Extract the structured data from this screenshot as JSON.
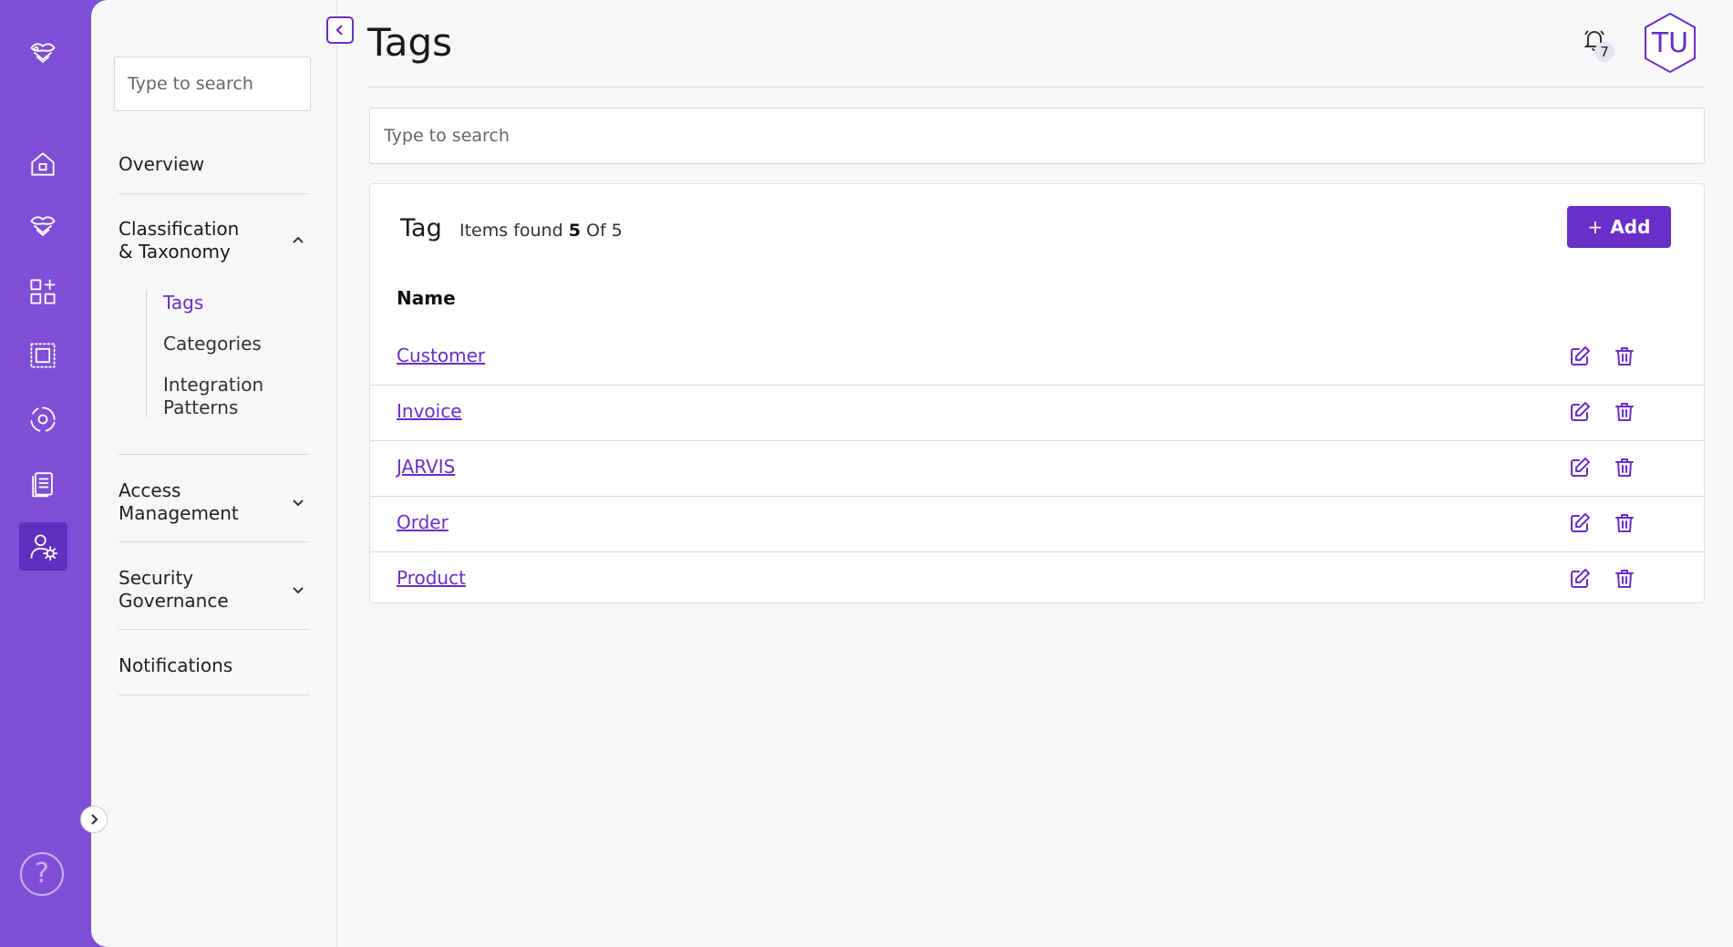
{
  "rail": {
    "icons": [
      "brand-logo-icon",
      "home-icon",
      "bee-icon",
      "apps-add-icon",
      "select-area-icon",
      "target-icon",
      "documents-icon",
      "user-settings-icon"
    ],
    "help_glyph": "?"
  },
  "subnav": {
    "search_placeholder": "Type to search",
    "overview": "Overview",
    "classification": "Classification & Taxonomy",
    "sub_items": [
      "Tags",
      "Categories",
      "Integration Patterns"
    ],
    "access": "Access Management",
    "security": "Security Governance",
    "notifications": "Notifications"
  },
  "header": {
    "title": "Tags",
    "notification_count": "7",
    "avatar_initials": "TU"
  },
  "main": {
    "search_placeholder": "Type to search",
    "card_title": "Tag",
    "items_found_label": "Items found",
    "items_found_count": "5",
    "items_found_total": "Of 5",
    "add_label": "Add",
    "column_name": "Name",
    "rows": [
      "Customer",
      "Invoice",
      "JARVIS",
      "Order",
      "Product"
    ]
  },
  "colors": {
    "accent": "#6a2fc8",
    "rail": "#7e4fd6"
  }
}
